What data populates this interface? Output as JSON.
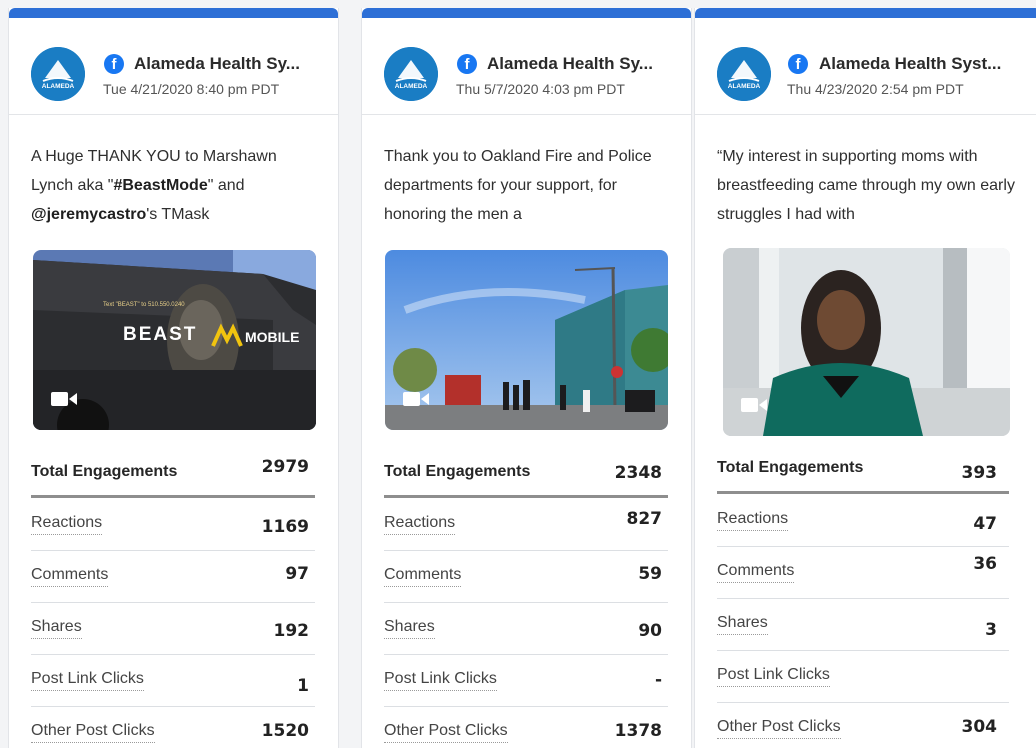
{
  "cards": [
    {
      "page_name": "Alameda Health Sy...",
      "date": "Tue 4/21/2020 8:40 pm PDT",
      "text_parts": [
        {
          "t": "A Huge THANK YOU to Marshawn Lynch aka \"",
          "b": false
        },
        {
          "t": "#BeastMode",
          "b": true
        },
        {
          "t": "\" and ",
          "b": false
        },
        {
          "t": "@jeremycastro",
          "b": true
        },
        {
          "t": "'s TMask",
          "b": false
        }
      ],
      "media_text": {
        "brand": "BEAST",
        "brand2": "MOBILE",
        "sub": "Text \"BEAST\" to 510.550.0240"
      },
      "metrics": [
        {
          "label": "Total Engagements",
          "value": "2979"
        },
        {
          "label": "Reactions",
          "value": "1169"
        },
        {
          "label": "Comments",
          "value": "97"
        },
        {
          "label": "Shares",
          "value": "192"
        },
        {
          "label": "Post Link Clicks",
          "value": "1"
        },
        {
          "label": "Other Post Clicks",
          "value": "1520"
        }
      ]
    },
    {
      "page_name": "Alameda Health Sy...",
      "date": "Thu 5/7/2020 4:03 pm PDT",
      "text_parts": [
        {
          "t": "Thank you to Oakland Fire and Police departments for your support, for honoring the men a",
          "b": false
        }
      ],
      "metrics": [
        {
          "label": "Total Engagements",
          "value": "2348"
        },
        {
          "label": "Reactions",
          "value": "827"
        },
        {
          "label": "Comments",
          "value": "59"
        },
        {
          "label": "Shares",
          "value": "90"
        },
        {
          "label": "Post Link Clicks",
          "value": "-"
        },
        {
          "label": "Other Post Clicks",
          "value": "1378"
        }
      ]
    },
    {
      "page_name": "Alameda Health Syst...",
      "date": "Thu 4/23/2020 2:54 pm PDT",
      "text_parts": [
        {
          "t": "“My interest in supporting moms with breastfeeding came through my own early struggles I had with",
          "b": false
        }
      ],
      "metrics": [
        {
          "label": "Total Engagements",
          "value": "393"
        },
        {
          "label": "Reactions",
          "value": "47"
        },
        {
          "label": "Comments",
          "value": "36"
        },
        {
          "label": "Shares",
          "value": "3"
        },
        {
          "label": "Post Link Clicks",
          "value": ""
        },
        {
          "label": "Other Post Clicks",
          "value": "304"
        }
      ]
    }
  ],
  "avatar_text": "ALAMEDA",
  "colors": {
    "accent": "#2d6fd6",
    "facebook": "#1877f2",
    "avatar": "#1a7dc4"
  },
  "icons": {
    "facebook": "facebook-icon",
    "video": "video-camera-icon",
    "avatar": "alameda-logo-icon"
  }
}
